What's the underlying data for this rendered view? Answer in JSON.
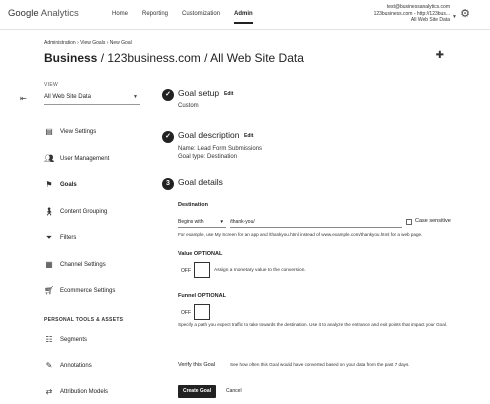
{
  "header": {
    "logo_main": "Google",
    "logo_sub": "Analytics",
    "nav": [
      "Home",
      "Reporting",
      "Customization",
      "Admin"
    ],
    "active_nav": "Admin",
    "account_email": "test@businessanalytics.com",
    "account_site": "123business.com - http://123bus...",
    "account_view": "All Web Site Data"
  },
  "breadcrumb": "Administration › View Goals › New Goal",
  "page_title_bold": "Business",
  "page_title_rest": " / 123business.com / All Web Site Data",
  "sidebar": {
    "view_label": "VIEW",
    "view_value": "All Web Site Data",
    "items": [
      {
        "label": "View Settings",
        "icon": "page-icon"
      },
      {
        "label": "User Management",
        "icon": "users-icon"
      },
      {
        "label": "Goals",
        "icon": "flag-icon"
      },
      {
        "label": "Content Grouping",
        "icon": "person-walk-icon"
      },
      {
        "label": "Filters",
        "icon": "filter-icon"
      },
      {
        "label": "Channel Settings",
        "icon": "channel-icon"
      },
      {
        "label": "Ecommerce Settings",
        "icon": "cart-icon"
      }
    ],
    "section_head": "PERSONAL TOOLS & ASSETS",
    "tools": [
      {
        "label": "Segments",
        "icon": "segments-icon"
      },
      {
        "label": "Annotations",
        "icon": "annotations-icon"
      },
      {
        "label": "Attribution Models",
        "icon": "attribution-icon"
      }
    ]
  },
  "steps": {
    "setup_title": "Goal setup",
    "setup_edit": "Edit",
    "setup_value": "Custom",
    "desc_title": "Goal description",
    "desc_edit": "Edit",
    "desc_name": "Name: Lead Form Submissions",
    "desc_type": "Goal type: Destination",
    "details_num": "3",
    "details_title": "Goal details"
  },
  "details": {
    "destination_head": "Destination",
    "match_type": "Begins with",
    "destination_value": "/thank-you/",
    "case_label": "Case sensitive",
    "destination_help": "For example, use My Screen for an app and /thankyou.html instead of www.example.com/thankyou.html for a web page.",
    "value_head": "Value OPTIONAL",
    "value_off": "OFF",
    "value_desc": "Assign a monetary value to the conversion.",
    "funnel_head": "Funnel OPTIONAL",
    "funnel_off": "OFF",
    "funnel_desc": "Specify a path you expect traffic to take towards the destination. Use it to analyze the entrance and exit points that impact your Goal.",
    "verify_label": "Verify this Goal",
    "verify_desc": "See how often this Goal would have converted based on your data from the past 7 days.",
    "create_button": "Create Goal",
    "cancel_button": "Cancel"
  }
}
